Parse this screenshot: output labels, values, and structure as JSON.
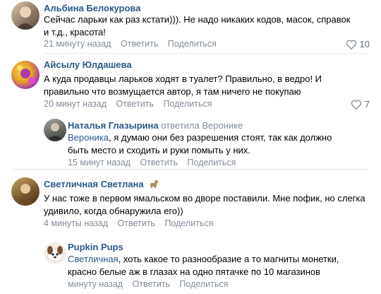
{
  "comments": [
    {
      "author": "Альбина Белокурова",
      "text": "Сейчас ларьки как раз кстати))). Не надо никаких кодов, масок, справок и т.д., красота!",
      "time": "21 минуту назад",
      "reply": "Ответить",
      "share": "Поделиться",
      "likes": "10"
    },
    {
      "author": "Айсылу Юлдашева",
      "text": "А куда продавцы ларьков ходят в туалет? Правильно, в ведро! И правильно что возмущается автор, я там ничего не покупаю",
      "time": "20 минут назад",
      "reply": "Ответить",
      "share": "Поделиться",
      "likes": "7"
    },
    {
      "author": "Наталья Глазырина",
      "replied_to": "ответила Веронике",
      "text": "Вероника, я думаю они без разрешения стоят, так как должно быть место и сходить и руки помыть у них.",
      "mention": "Вероника",
      "time": "15 минут назад",
      "reply": "Ответить",
      "share": "Поделиться"
    },
    {
      "author": "Светличная Светлана",
      "text": "У нас тоже в первом ямальском во дворе поставили. Мне пофик, но слегка удивило, когда обнаружила его))",
      "time": "4 минуты назад",
      "reply": "Ответить",
      "share": "Поделиться"
    },
    {
      "author": "Pupkin Pups",
      "text": "Светличная, хоть какое то разнообразие а то магниты монетки, красно белые аж в глазах на одно пятачке по 10 магазинов",
      "mention": "Светличная",
      "time": "минуту назад",
      "reply": "Ответить",
      "share": "Поделиться"
    }
  ],
  "colors": {
    "author": "#2a5885",
    "meta": "#818c99",
    "divider": "#e7e8ec"
  },
  "icons": {
    "like": "heart-outline-icon",
    "badge": "dog-icon"
  }
}
